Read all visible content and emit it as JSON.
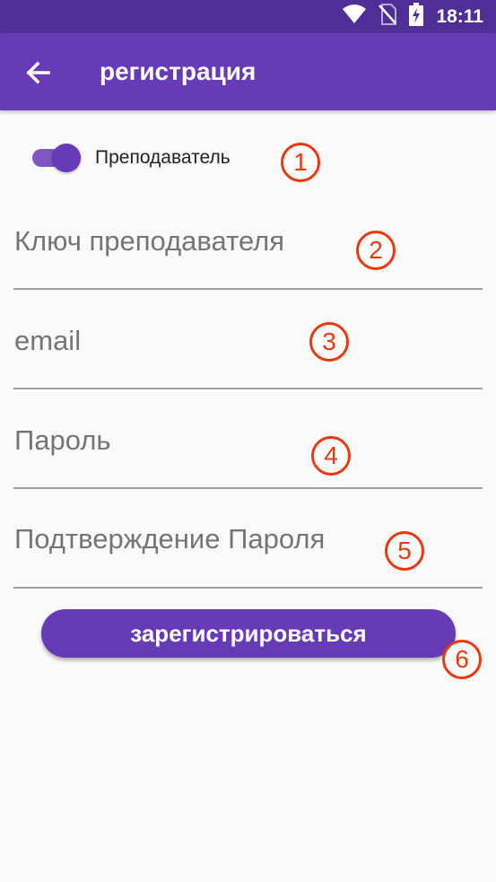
{
  "status_bar": {
    "time": "18:11",
    "icons": [
      "wifi-icon",
      "no-sim-icon",
      "battery-charging-icon"
    ]
  },
  "app_bar": {
    "title": "регистрация",
    "back_icon": "arrow-back-icon"
  },
  "teacher_toggle": {
    "label": "Преподаватель",
    "checked": true
  },
  "fields": {
    "teacher_key": {
      "placeholder": "Ключ преподавателя"
    },
    "email": {
      "placeholder": "email"
    },
    "password": {
      "placeholder": "Пароль"
    },
    "password_confirm": {
      "placeholder": "Подтверждение Пароля"
    }
  },
  "register_button": {
    "label": "зарегистрироваться"
  },
  "markers": [
    "1",
    "2",
    "3",
    "4",
    "5",
    "6"
  ],
  "colors": {
    "primary": "#673ab7",
    "primary_dark": "#4f2f96",
    "marker": "#f0360d"
  }
}
